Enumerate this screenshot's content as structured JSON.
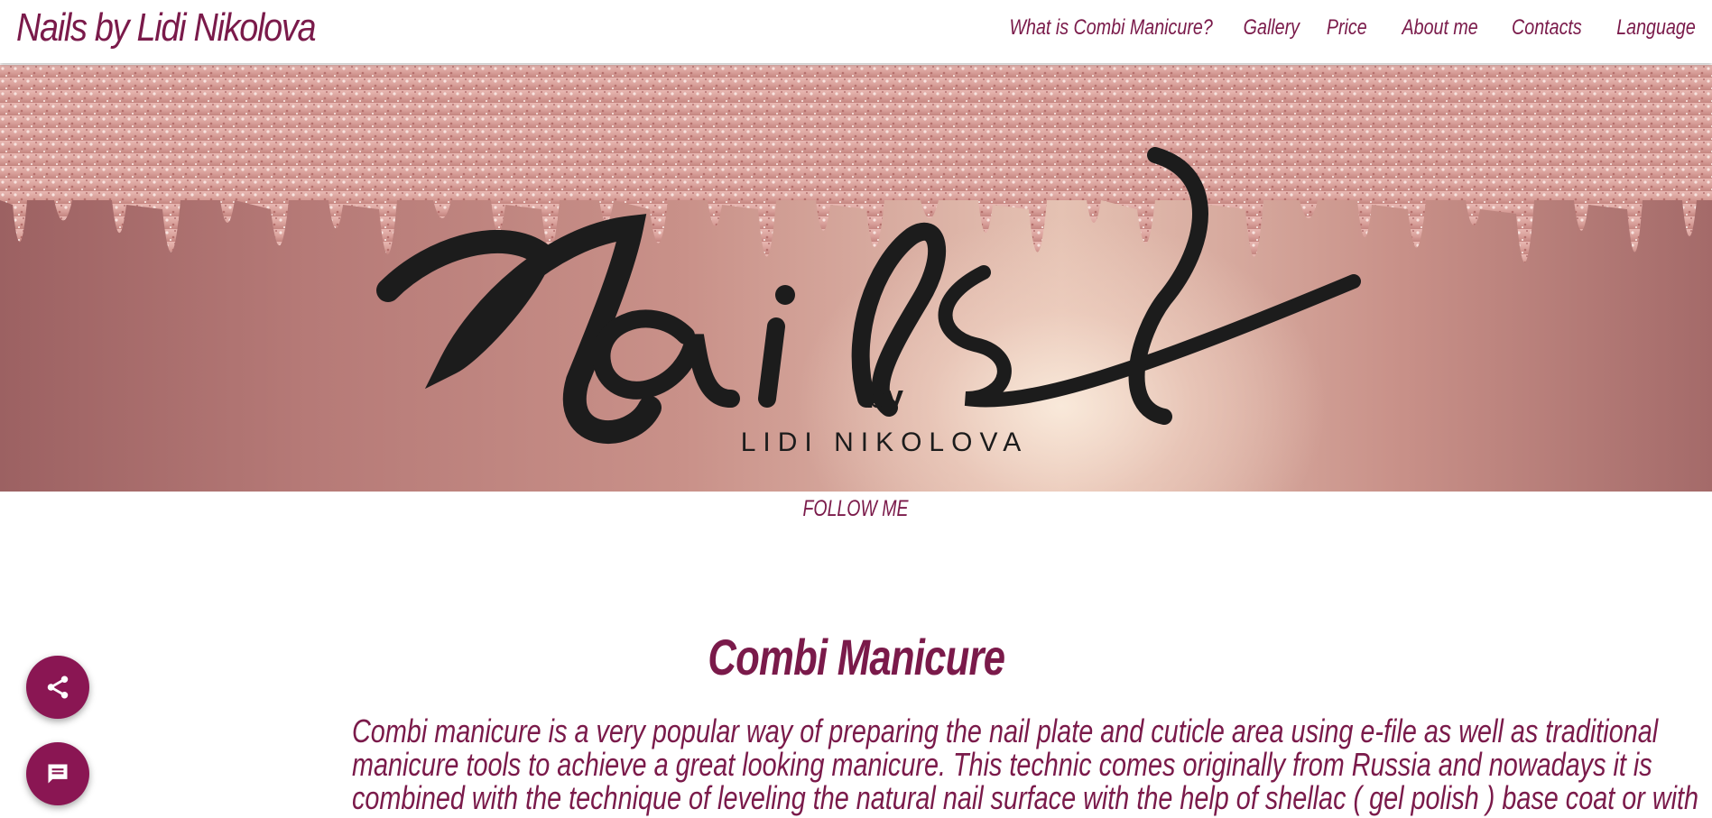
{
  "header": {
    "site_title": "Nails by Lidi Nikolova",
    "nav": [
      {
        "label": "What is Combi Manicure?"
      },
      {
        "label": "Gallery"
      },
      {
        "label": "Price"
      },
      {
        "label": "About me"
      },
      {
        "label": "Contacts"
      },
      {
        "label": "Language"
      }
    ]
  },
  "hero": {
    "logo_script": "Nails",
    "logo_by": "by",
    "logo_name": "LIDI NIKOLOVA"
  },
  "follow": {
    "label": "FOLLOW ME"
  },
  "main": {
    "title": "Combi Manicure",
    "intro_lines": [
      "Combi manicure is a very popular way of preparing the nail plate and cuticle area using e-file as well as traditional",
      "manicure tools to achieve a great looking manicure. This technic comes originally from Russia and nowadays it is",
      "combined with the technique of leveling the natural nail surface with the help of shellac ( gel polish ) base coat or with"
    ]
  },
  "fabs": {
    "share_icon": "share-icon",
    "chat_icon": "chat-icon"
  },
  "colors": {
    "brand": "#7a1a4a",
    "fab": "#8a1653"
  }
}
